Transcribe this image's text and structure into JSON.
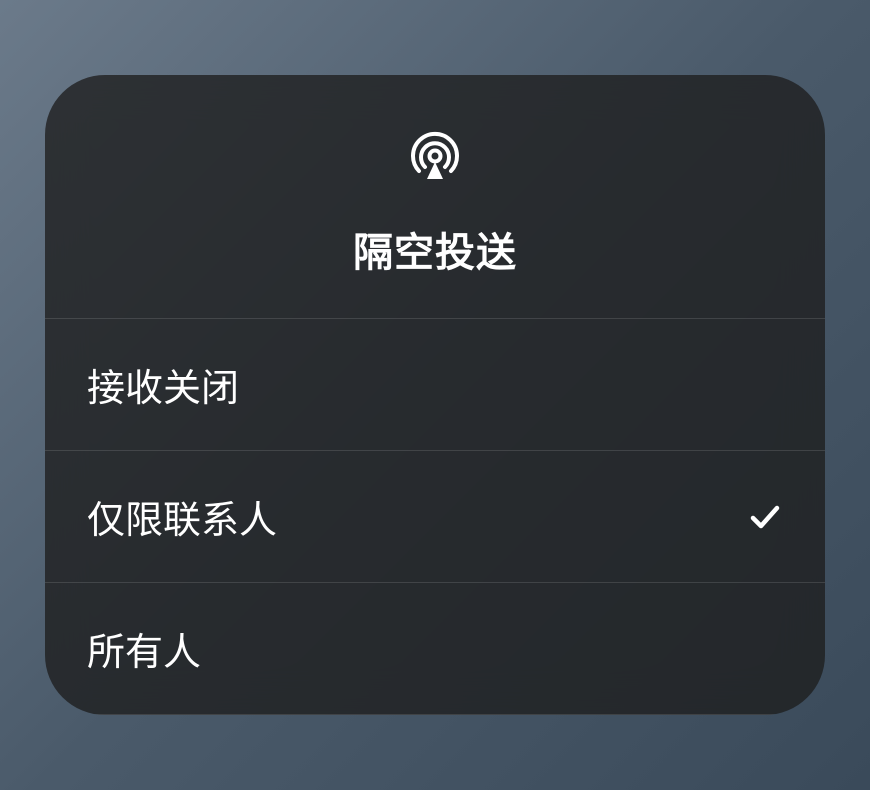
{
  "title": "隔空投送",
  "options": [
    {
      "label": "接收关闭",
      "selected": false
    },
    {
      "label": "仅限联系人",
      "selected": true
    },
    {
      "label": "所有人",
      "selected": false
    }
  ]
}
